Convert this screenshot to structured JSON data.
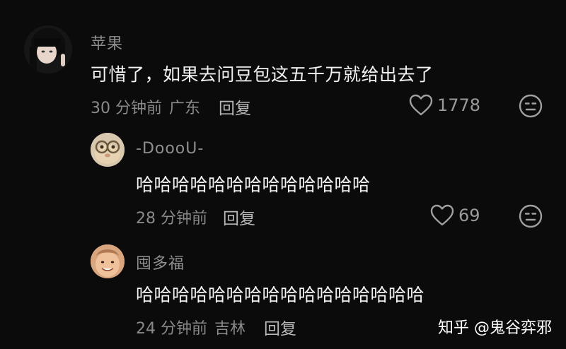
{
  "comments": [
    {
      "author": "苹果",
      "content": "可惜了，如果去问豆包这五千万就给出去了",
      "time": "30 分钟前",
      "location": "广东",
      "reply_label": "回复",
      "likes": "1778"
    },
    {
      "author": "-DoooU-",
      "content": "哈哈哈哈哈哈哈哈哈哈哈哈哈",
      "time": "28 分钟前",
      "location": "",
      "reply_label": "回复",
      "likes": "69"
    },
    {
      "author": "囤多福",
      "content": "哈哈哈哈哈哈哈哈哈哈哈哈哈哈哈哈",
      "time": "24 分钟前",
      "location": "吉林",
      "reply_label": "回复",
      "likes": ""
    }
  ],
  "watermark": "知乎 @鬼谷弈邪",
  "icons": {
    "like": "heart-outline-icon",
    "dislike": "meh-face-icon"
  },
  "colors": {
    "background": "#0b0b0b",
    "author": "#8f8f8f",
    "text": "#f2f2f2"
  }
}
